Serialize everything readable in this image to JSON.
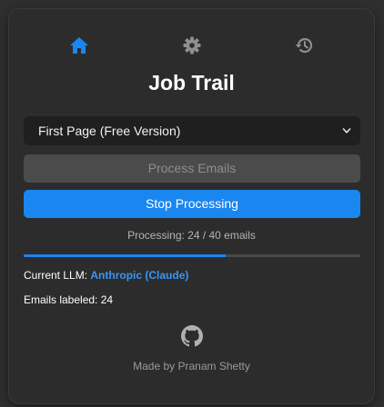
{
  "nav": {
    "items": [
      {
        "icon": "home-icon",
        "active": true
      },
      {
        "icon": "gear-icon",
        "active": false
      },
      {
        "icon": "history-icon",
        "active": false
      }
    ]
  },
  "app": {
    "title": "Job Trail"
  },
  "mode_select": {
    "selected": "First Page (Free Version)"
  },
  "actions": {
    "process_label": "Process Emails",
    "stop_label": "Stop Processing"
  },
  "progress": {
    "status_text": "Processing: 24 / 40 emails",
    "processed": 24,
    "total": 40
  },
  "llm": {
    "label": "Current LLM:",
    "value": "Anthropic (Claude)"
  },
  "labeled": {
    "text": "Emails labeled: 24"
  },
  "footer": {
    "icon": "github-icon",
    "credit": "Made by Pranam Shetty"
  },
  "colors": {
    "accent": "#1a86f0",
    "link": "#3a96f5",
    "panel_bg": "#2c2c2c"
  }
}
